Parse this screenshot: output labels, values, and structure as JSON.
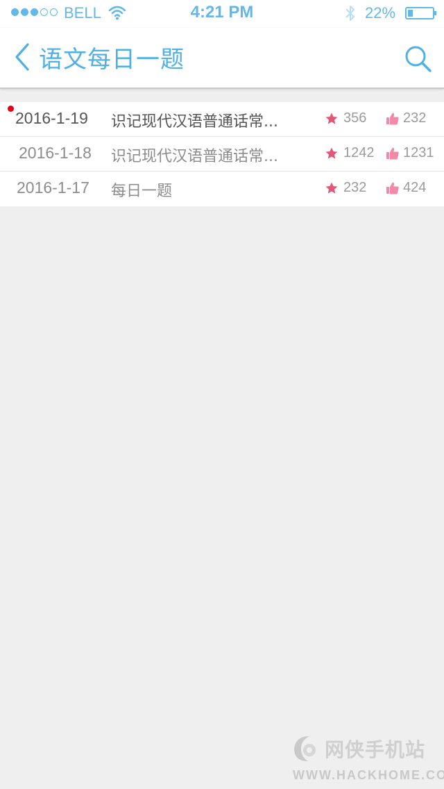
{
  "status_bar": {
    "carrier": "BELL",
    "time": "4:21 PM",
    "battery_percent": "22%",
    "battery_level": 0.22,
    "signal_strength": 3,
    "signal_max": 5
  },
  "nav": {
    "title": "语文每日一题",
    "back_icon": "chevron-left-icon",
    "search_icon": "search-icon"
  },
  "list": {
    "rows": [
      {
        "date": "2016-1-19",
        "title": "识记现代汉语普通话常...",
        "stars": "356",
        "likes": "232",
        "unread": true
      },
      {
        "date": "2016-1-18",
        "title": "识记现代汉语普通话常...",
        "stars": "1242",
        "likes": "1231",
        "unread": false
      },
      {
        "date": "2016-1-17",
        "title": "每日一题",
        "stars": "232",
        "likes": "424",
        "unread": false
      }
    ]
  },
  "watermark": {
    "text": "网侠手机站",
    "url": "WWW.HACKHOME.COM"
  },
  "colors": {
    "accent": "#4fb0e6",
    "star": "#e05a78",
    "like": "#f08aa8",
    "unread_dot": "#e60012",
    "background": "#efefef"
  }
}
